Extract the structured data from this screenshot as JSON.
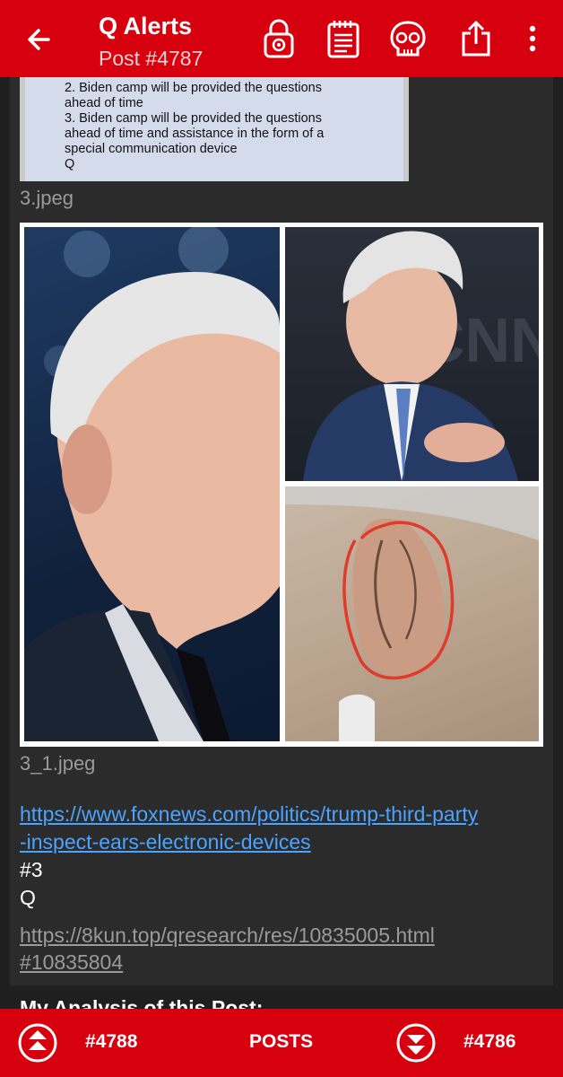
{
  "appbar": {
    "title": "Q Alerts",
    "subtitle": "Post #4787",
    "icons": [
      "back-arrow-icon",
      "lock-icon",
      "notepad-icon",
      "skull-icon",
      "share-icon",
      "more-vert-icon"
    ]
  },
  "doc_image": {
    "lines": [
      "2. Biden camp will be provided the questions",
      "ahead of time",
      "3. Biden camp will be provided the questions",
      "ahead of time and assistance in the form of a",
      "special communication device",
      "Q"
    ]
  },
  "captions": {
    "first": "3.jpeg",
    "second": "3_1.jpeg"
  },
  "post": {
    "link_line1": "https://www.foxnews.com/politics/trump-third-party",
    "link_line2": "-inspect-ears-electronic-devices",
    "tag": "#3",
    "signature": "Q",
    "source_line1": "https://8kun.top/qresearch/res/10835005.html",
    "source_line2": "#10835804"
  },
  "analysis_heading": "My Analysis of this Post:",
  "bottom": {
    "prev_label": "#4788",
    "center_label": "POSTS",
    "next_label": "#4786"
  },
  "colors": {
    "accent": "#d7000f",
    "background": "#1f1f1f",
    "card": "#2b2b2b",
    "link": "#4aa3ff"
  }
}
